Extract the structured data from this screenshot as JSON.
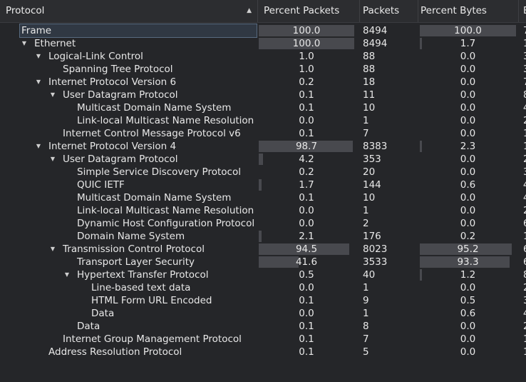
{
  "columns": {
    "protocol": "Protocol",
    "percent_packets": "Percent Packets",
    "packets": "Packets",
    "percent_bytes": "Percent Bytes",
    "extra": "B"
  },
  "rows": [
    {
      "protocol": "Frame",
      "depth": 0,
      "expander": "open",
      "percent_packets": "100.0",
      "pp_bar": 1.0,
      "packets": "8494",
      "percent_bytes": "100.0",
      "pb_bar": 1.0,
      "extra": "7"
    },
    {
      "protocol": "Ethernet",
      "depth": 1,
      "expander": "open",
      "percent_packets": "100.0",
      "pp_bar": 1.0,
      "packets": "8494",
      "percent_bytes": "1.7",
      "pb_bar": 0.017,
      "extra": "1"
    },
    {
      "protocol": "Logical-Link Control",
      "depth": 2,
      "expander": "open",
      "percent_packets": "1.0",
      "pp_bar": 0.0,
      "packets": "88",
      "percent_bytes": "0.0",
      "pb_bar": 0.0,
      "extra": "3"
    },
    {
      "protocol": "Spanning Tree Protocol",
      "depth": 3,
      "expander": "none",
      "percent_packets": "1.0",
      "pp_bar": 0.0,
      "packets": "88",
      "percent_bytes": "0.0",
      "pb_bar": 0.0,
      "extra": "3"
    },
    {
      "protocol": "Internet Protocol Version 6",
      "depth": 2,
      "expander": "open",
      "percent_packets": "0.2",
      "pp_bar": 0.0,
      "packets": "18",
      "percent_bytes": "0.0",
      "pb_bar": 0.0,
      "extra": "7"
    },
    {
      "protocol": "User Datagram Protocol",
      "depth": 3,
      "expander": "open",
      "percent_packets": "0.1",
      "pp_bar": 0.0,
      "packets": "11",
      "percent_bytes": "0.0",
      "pb_bar": 0.0,
      "extra": "8"
    },
    {
      "protocol": "Multicast Domain Name System",
      "depth": 4,
      "expander": "none",
      "percent_packets": "0.1",
      "pp_bar": 0.0,
      "packets": "10",
      "percent_bytes": "0.0",
      "pb_bar": 0.0,
      "extra": "4"
    },
    {
      "protocol": "Link-local Multicast Name Resolution",
      "depth": 4,
      "expander": "none",
      "percent_packets": "0.0",
      "pp_bar": 0.0,
      "packets": "1",
      "percent_bytes": "0.0",
      "pb_bar": 0.0,
      "extra": "2"
    },
    {
      "protocol": "Internet Control Message Protocol v6",
      "depth": 3,
      "expander": "none",
      "percent_packets": "0.1",
      "pp_bar": 0.0,
      "packets": "7",
      "percent_bytes": "0.0",
      "pb_bar": 0.0,
      "extra": "1"
    },
    {
      "protocol": "Internet Protocol Version 4",
      "depth": 2,
      "expander": "open",
      "percent_packets": "98.7",
      "pp_bar": 0.987,
      "packets": "8383",
      "percent_bytes": "2.3",
      "pb_bar": 0.023,
      "extra": "1"
    },
    {
      "protocol": "User Datagram Protocol",
      "depth": 3,
      "expander": "open",
      "percent_packets": "4.2",
      "pp_bar": 0.042,
      "packets": "353",
      "percent_bytes": "0.0",
      "pb_bar": 0.0,
      "extra": "2"
    },
    {
      "protocol": "Simple Service Discovery Protocol",
      "depth": 4,
      "expander": "none",
      "percent_packets": "0.2",
      "pp_bar": 0.0,
      "packets": "20",
      "percent_bytes": "0.0",
      "pb_bar": 0.0,
      "extra": "3"
    },
    {
      "protocol": "QUIC IETF",
      "depth": 4,
      "expander": "none",
      "percent_packets": "1.7",
      "pp_bar": 0.017,
      "packets": "144",
      "percent_bytes": "0.6",
      "pb_bar": 0.0,
      "extra": "4"
    },
    {
      "protocol": "Multicast Domain Name System",
      "depth": 4,
      "expander": "none",
      "percent_packets": "0.1",
      "pp_bar": 0.0,
      "packets": "10",
      "percent_bytes": "0.0",
      "pb_bar": 0.0,
      "extra": "4"
    },
    {
      "protocol": "Link-local Multicast Name Resolution",
      "depth": 4,
      "expander": "none",
      "percent_packets": "0.0",
      "pp_bar": 0.0,
      "packets": "1",
      "percent_bytes": "0.0",
      "pb_bar": 0.0,
      "extra": "2"
    },
    {
      "protocol": "Dynamic Host Configuration Protocol",
      "depth": 4,
      "expander": "none",
      "percent_packets": "0.0",
      "pp_bar": 0.0,
      "packets": "2",
      "percent_bytes": "0.0",
      "pb_bar": 0.0,
      "extra": "6"
    },
    {
      "protocol": "Domain Name System",
      "depth": 4,
      "expander": "none",
      "percent_packets": "2.1",
      "pp_bar": 0.021,
      "packets": "176",
      "percent_bytes": "0.2",
      "pb_bar": 0.0,
      "extra": "1"
    },
    {
      "protocol": "Transmission Control Protocol",
      "depth": 3,
      "expander": "open",
      "percent_packets": "94.5",
      "pp_bar": 0.945,
      "packets": "8023",
      "percent_bytes": "95.2",
      "pb_bar": 0.952,
      "extra": "6"
    },
    {
      "protocol": "Transport Layer Security",
      "depth": 4,
      "expander": "none",
      "percent_packets": "41.6",
      "pp_bar": 0.416,
      "packets": "3533",
      "percent_bytes": "93.3",
      "pb_bar": 0.933,
      "extra": "6"
    },
    {
      "protocol": "Hypertext Transfer Protocol",
      "depth": 4,
      "expander": "open",
      "percent_packets": "0.5",
      "pp_bar": 0.0,
      "packets": "40",
      "percent_bytes": "1.2",
      "pb_bar": 0.012,
      "extra": "8"
    },
    {
      "protocol": "Line-based text data",
      "depth": 5,
      "expander": "none",
      "percent_packets": "0.0",
      "pp_bar": 0.0,
      "packets": "1",
      "percent_bytes": "0.0",
      "pb_bar": 0.0,
      "extra": "2"
    },
    {
      "protocol": "HTML Form URL Encoded",
      "depth": 5,
      "expander": "none",
      "percent_packets": "0.1",
      "pp_bar": 0.0,
      "packets": "9",
      "percent_bytes": "0.5",
      "pb_bar": 0.0,
      "extra": "3"
    },
    {
      "protocol": "Data",
      "depth": 5,
      "expander": "none",
      "percent_packets": "0.0",
      "pp_bar": 0.0,
      "packets": "1",
      "percent_bytes": "0.6",
      "pb_bar": 0.0,
      "extra": "4"
    },
    {
      "protocol": "Data",
      "depth": 4,
      "expander": "none",
      "percent_packets": "0.1",
      "pp_bar": 0.0,
      "packets": "8",
      "percent_bytes": "0.0",
      "pb_bar": 0.0,
      "extra": "2"
    },
    {
      "protocol": "Internet Group Management Protocol",
      "depth": 3,
      "expander": "none",
      "percent_packets": "0.1",
      "pp_bar": 0.0,
      "packets": "7",
      "percent_bytes": "0.0",
      "pb_bar": 0.0,
      "extra": "1"
    },
    {
      "protocol": "Address Resolution Protocol",
      "depth": 2,
      "expander": "none",
      "percent_packets": "0.1",
      "pp_bar": 0.0,
      "packets": "5",
      "percent_bytes": "0.0",
      "pb_bar": 0.0,
      "extra": "1"
    }
  ],
  "icons": {
    "sort": "sort-ascending-icon",
    "expand_open": "chevron-down-icon"
  },
  "colors": {
    "background": "#252629",
    "bar": "#48494e",
    "selected_row": "#303843"
  }
}
